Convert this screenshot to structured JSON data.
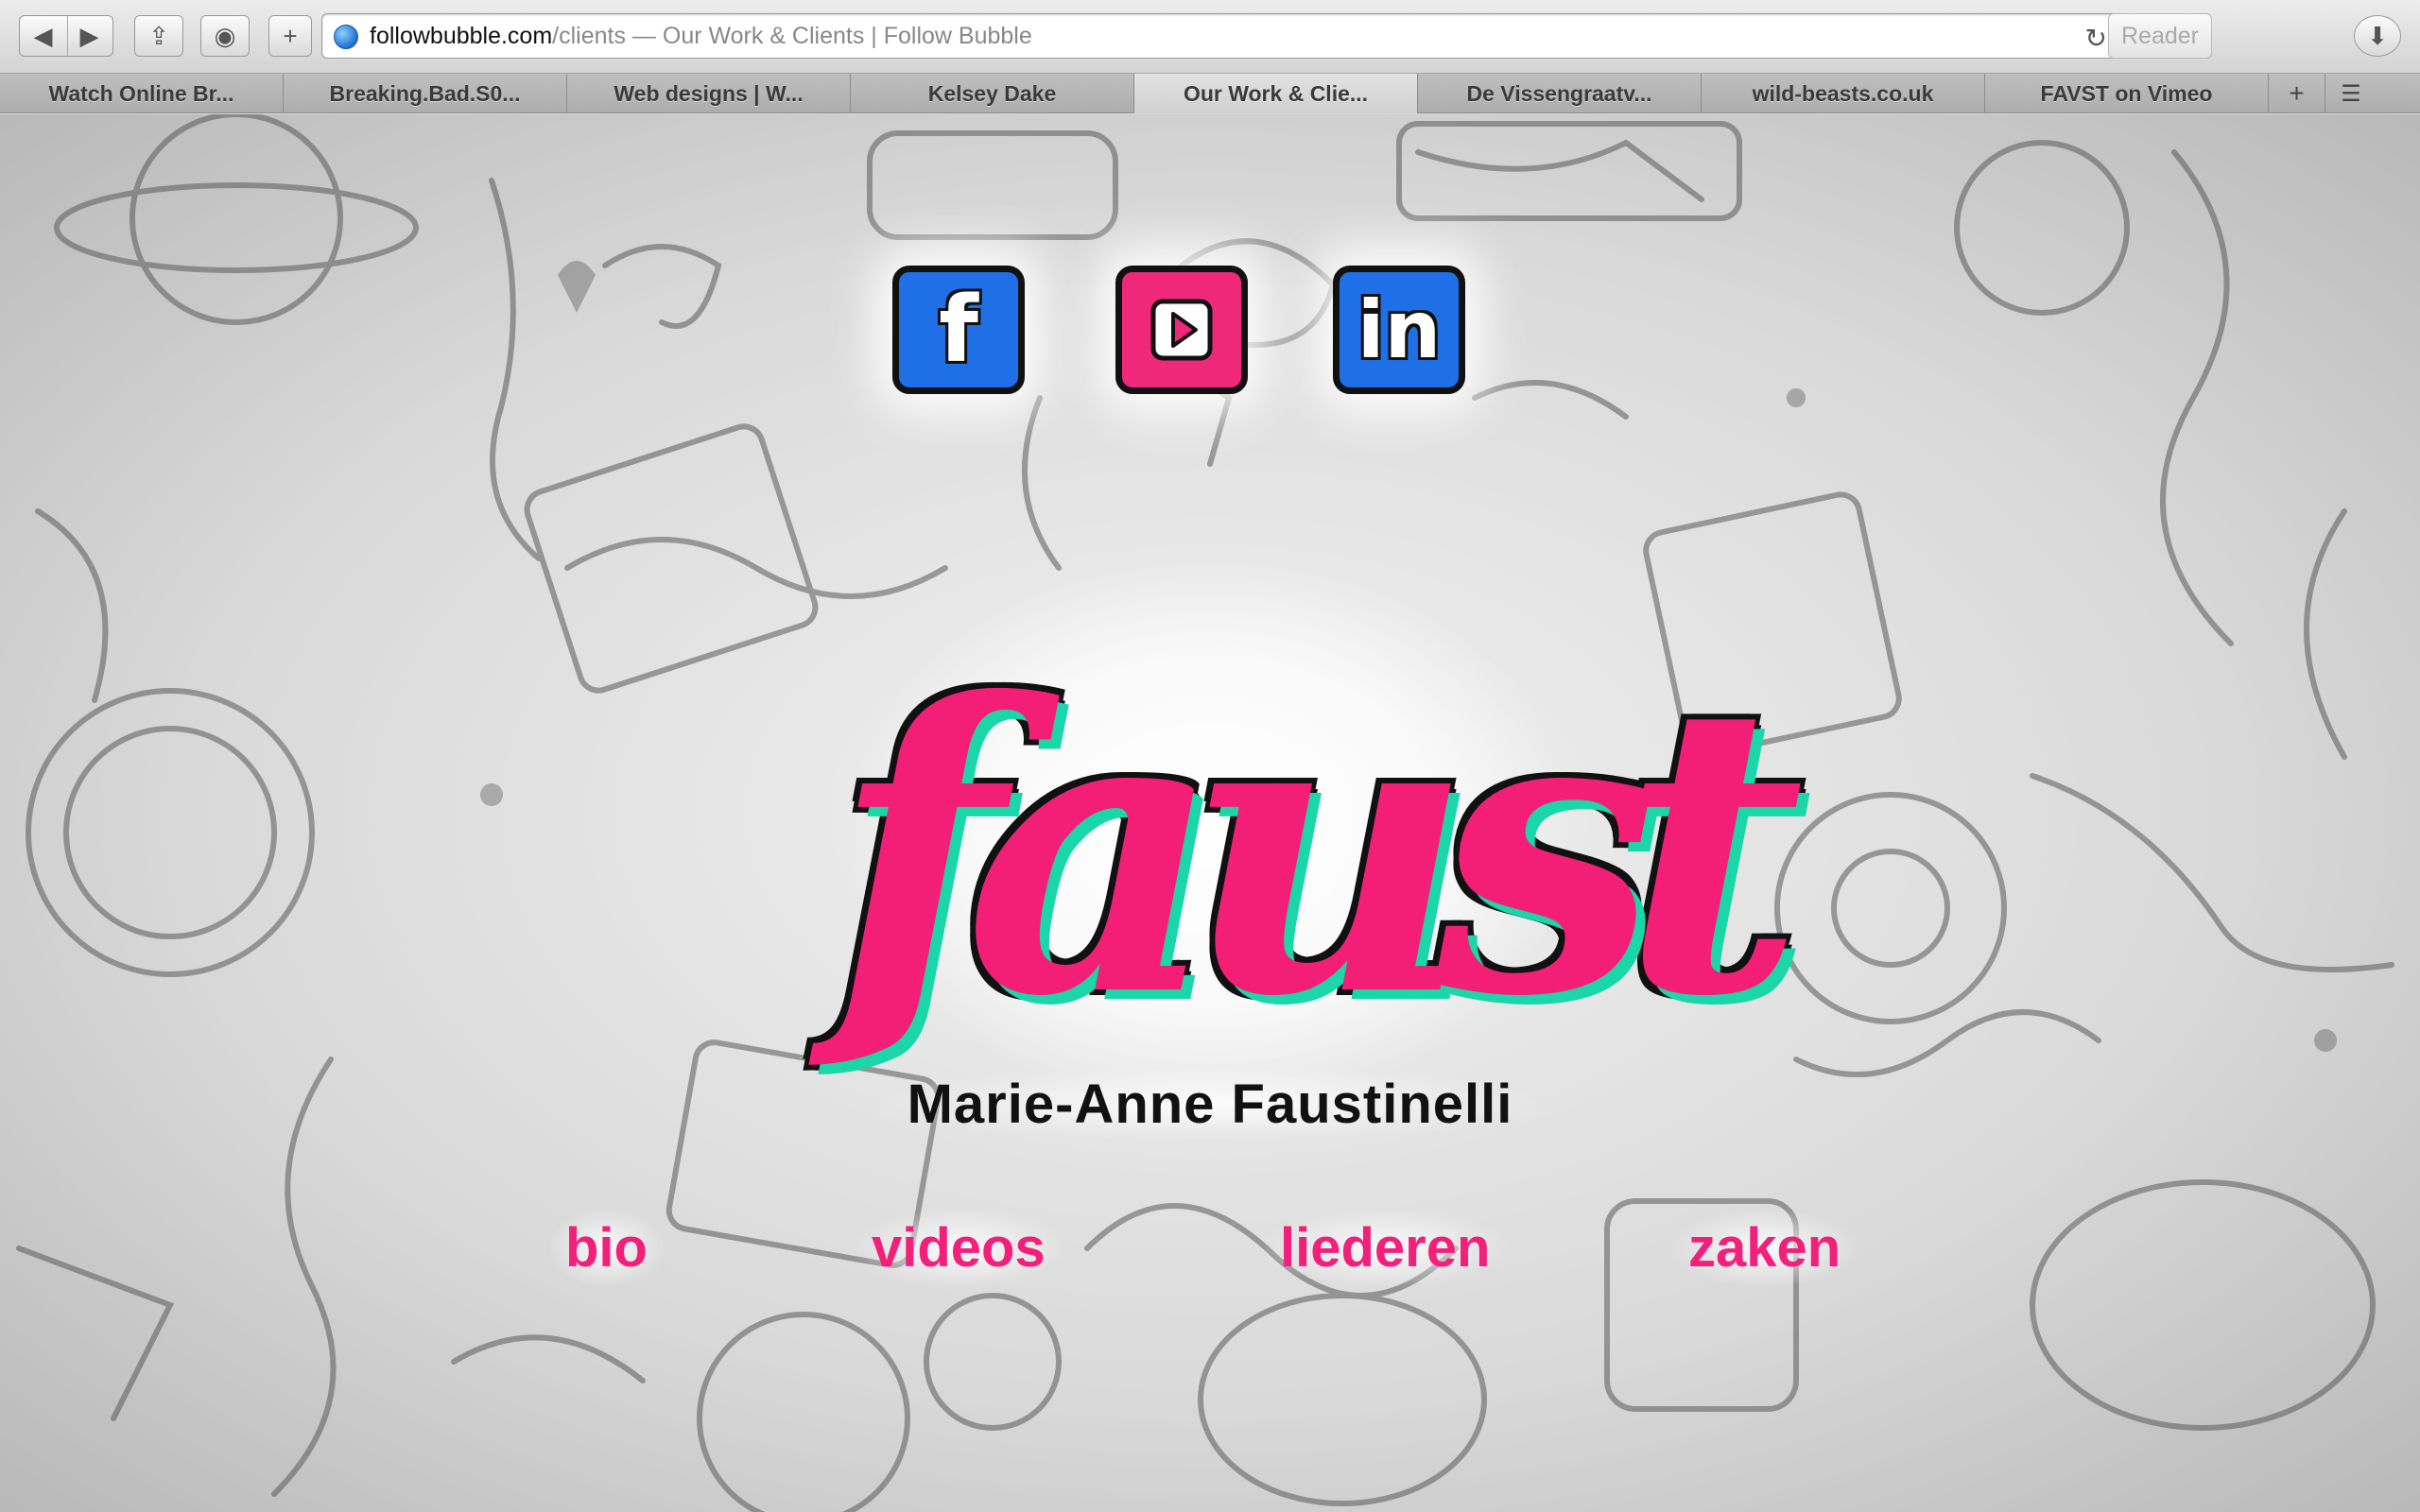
{
  "browser": {
    "url_domain": "followbubble.com",
    "url_path": "/clients",
    "page_title": " — Our Work & Clients | Follow Bubble",
    "reader_label": "Reader",
    "tabs": [
      {
        "label": "Watch Online Br..."
      },
      {
        "label": "Breaking.Bad.S0..."
      },
      {
        "label": "Web designs | W..."
      },
      {
        "label": "Kelsey Dake"
      },
      {
        "label": "Our Work & Clie...",
        "active": true
      },
      {
        "label": "De Vissengraatv..."
      },
      {
        "label": "wild-beasts.co.uk"
      },
      {
        "label": "FAVST on Vimeo"
      }
    ]
  },
  "site": {
    "social": {
      "facebook_glyph": "f",
      "youtube_icon": "play-icon",
      "linkedin_glyph": "in"
    },
    "logo_text": "faust",
    "artist_name": "Marie-Anne Faustinelli",
    "nav": [
      "bio",
      "videos",
      "liederen",
      "zaken"
    ],
    "colors": {
      "accent_pink": "#f2207a",
      "logo_shadow_teal": "#1bd6a8",
      "social_blue": "#1f6fe6"
    }
  }
}
